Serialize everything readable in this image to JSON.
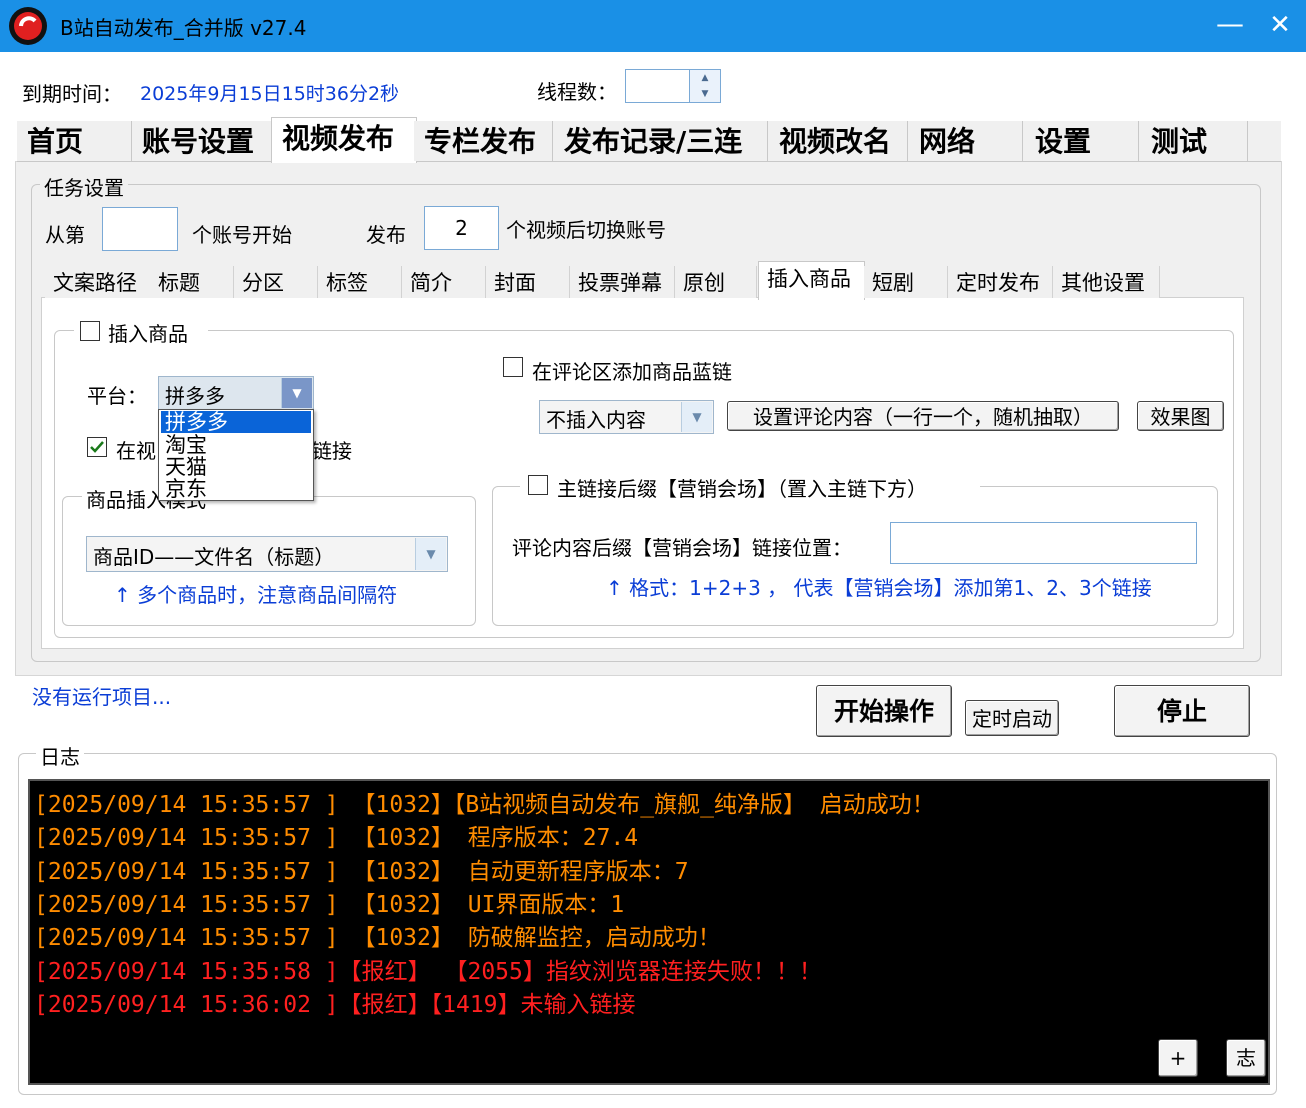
{
  "window": {
    "title": "B站自动发布_合并版    v27.4",
    "minimize_icon": "—",
    "close_icon": "✕"
  },
  "header": {
    "expire_label": "到期时间：",
    "expire_value": "2025年9月15日15时36分2秒",
    "thread_label": "线程数：",
    "thread_value": ""
  },
  "main_tabs": [
    "首页",
    "账号设置",
    "视频发布",
    "专栏发布",
    "发布记录/三连",
    "视频改名",
    "网络",
    "设置",
    "测试"
  ],
  "task_settings": {
    "group_label": "任务设置",
    "from_label": "从第",
    "from_value": "",
    "account_start_label": "个账号开始",
    "publish_label": "发布",
    "publish_value": "2",
    "switch_label": "个视频后切换账号"
  },
  "sub_tabs": [
    "文案路径",
    "标题",
    "分区",
    "标签",
    "简介",
    "封面",
    "投票弹幕",
    "原创",
    "插入商品",
    "短剧",
    "定时发布",
    "其他设置"
  ],
  "insert_goods": {
    "group_label": "插入商品",
    "platform_label": "平台：",
    "platform_value": "拼多多",
    "platform_options": [
      "拼多多",
      "淘宝",
      "天猫",
      "京东"
    ],
    "in_video_label": "在视",
    "link_suffix_label": "链接",
    "insert_mode_group": "商品插入模式",
    "insert_mode_value": "商品ID——文件名（标题）",
    "insert_mode_tip": "↑ 多个商品时，注意商品间隔符",
    "comment_blue_link_label": "在评论区添加商品蓝链",
    "comment_combo_value": "不插入内容",
    "set_comment_button": "设置评论内容（一行一个，随机抽取）",
    "effect_button": "效果图",
    "main_link_suffix_label": "主链接后缀【营销会场】（置入主链下方）",
    "comment_suffix_label": "评论内容后缀【营销会场】链接位置：",
    "comment_suffix_value": "",
    "format_tip": "↑ 格式：1+2+3 ，  代表【营销会场】添加第1、2、3个链接"
  },
  "status": {
    "running_text": "没有运行项目..."
  },
  "actions": {
    "start_button": "开始操作",
    "timer_button": "定时启动",
    "stop_button": "停止"
  },
  "log": {
    "group_label": "日志",
    "lines": [
      "[2025/09/14 15:35:57 ] 【1032】【B站视频自动发布_旗舰_纯净版】 启动成功！",
      "[2025/09/14 15:35:57 ] 【1032】 程序版本：27.4",
      "[2025/09/14 15:35:57 ] 【1032】 自动更新程序版本：7",
      "[2025/09/14 15:35:57 ] 【1032】 UI界面版本：1",
      "[2025/09/14 15:35:57 ] 【1032】 防破解监控，启动成功！",
      "[2025/09/14 15:35:58 ]【报红】 【2055】指纹浏览器连接失败！！！",
      "[2025/09/14 15:36:02 ]【报红】【1419】未输入链接"
    ],
    "colors": {
      "info": "#ff8c00",
      "error": "#ff2020"
    },
    "plus_button": "+",
    "log_button": "志"
  },
  "colors": {
    "titlebar": "#1a90e6",
    "tip_blue": "#0a3dd6"
  },
  "checks": {
    "insert_goods": false,
    "in_video": true,
    "comment_blue_link": false,
    "main_link_suffix": false
  }
}
